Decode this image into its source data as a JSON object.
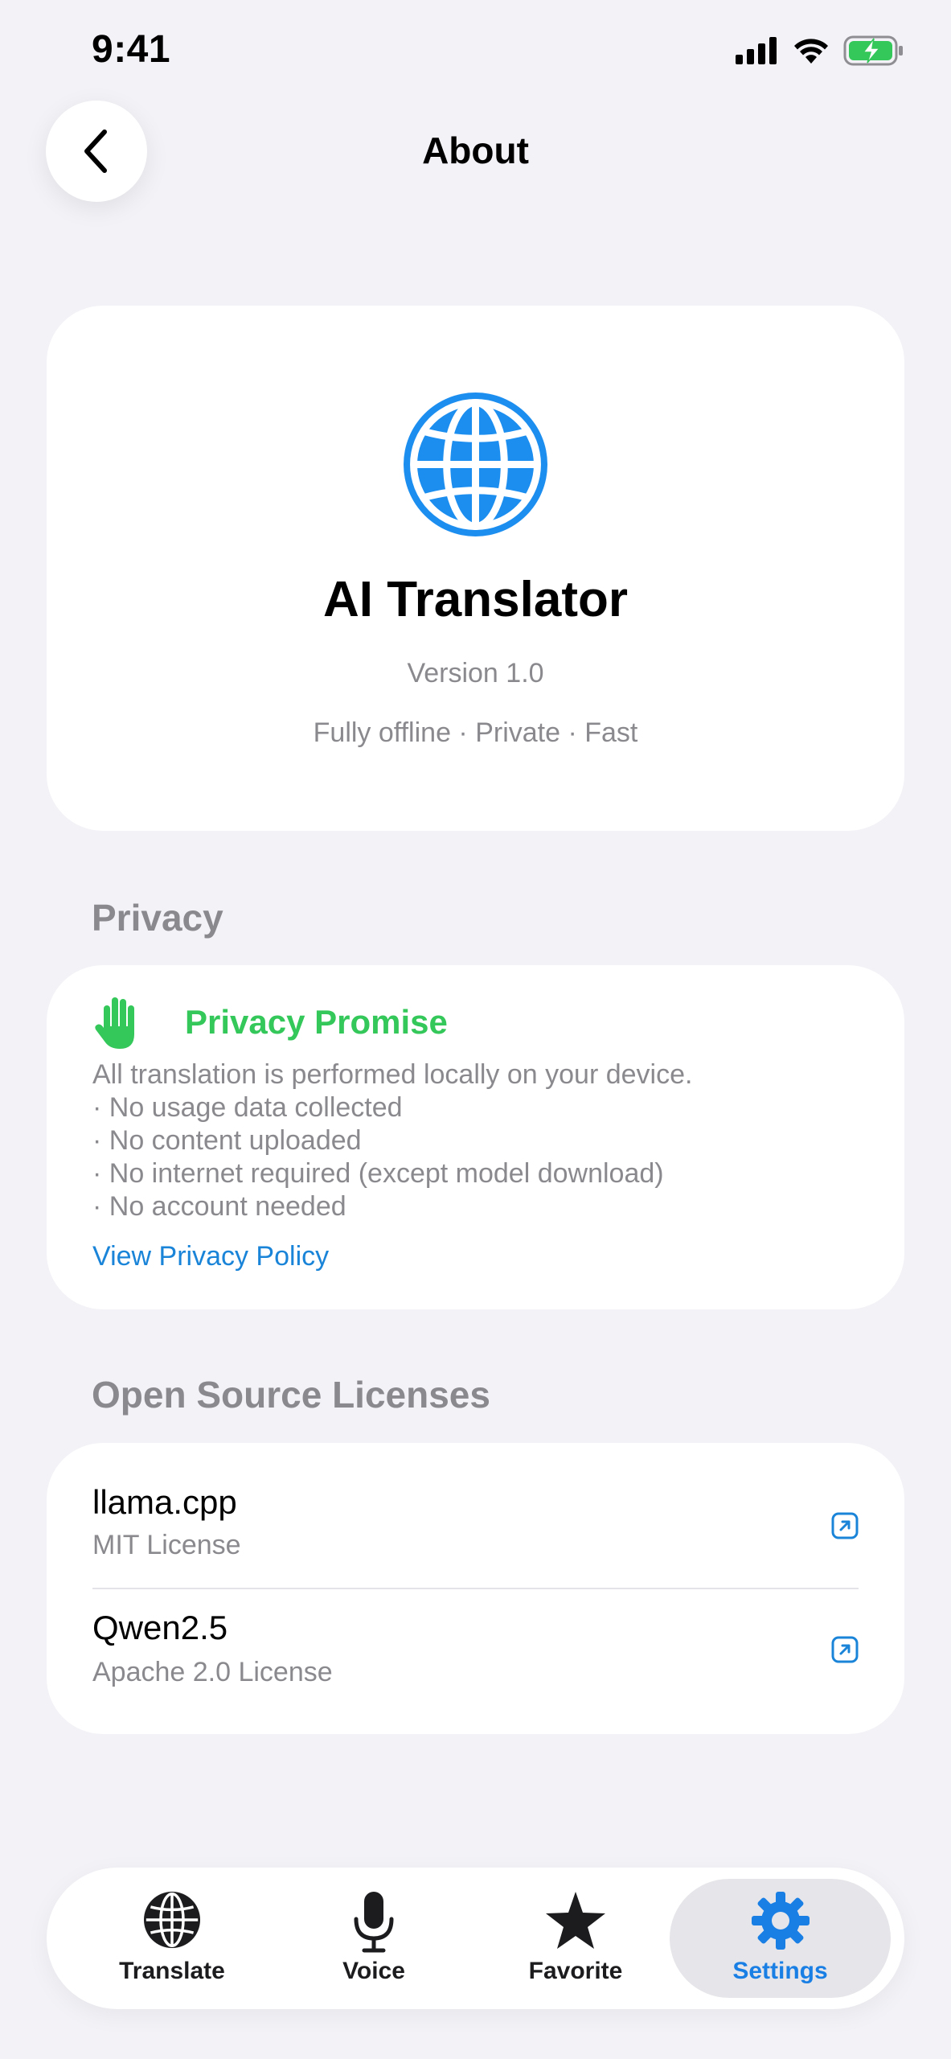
{
  "status_bar": {
    "time": "9:41"
  },
  "header": {
    "title": "About",
    "back_icon": "chevron-left-icon"
  },
  "app_info": {
    "icon": "globe-icon",
    "name": "AI Translator",
    "version": "Version 1.0",
    "tagline": "Fully offline · Private · Fast"
  },
  "privacy": {
    "section_title": "Privacy",
    "card_title": "Privacy Promise",
    "icon": "hand-raised-icon",
    "lines": [
      "All translation is performed locally on your device.",
      "· No usage data collected",
      "· No content uploaded",
      "· No internet required (except model download)",
      "· No account needed"
    ],
    "link_label": "View Privacy Policy"
  },
  "licenses": {
    "section_title": "Open Source Licenses",
    "items": [
      {
        "name": "llama.cpp",
        "license": "MIT License"
      },
      {
        "name": "Qwen2.5",
        "license": "Apache 2.0 License"
      }
    ]
  },
  "tab_bar": {
    "tabs": [
      {
        "label": "Translate",
        "icon": "globe-icon",
        "active": false
      },
      {
        "label": "Voice",
        "icon": "microphone-icon",
        "active": false
      },
      {
        "label": "Favorite",
        "icon": "star-icon",
        "active": false
      },
      {
        "label": "Settings",
        "icon": "gear-icon",
        "active": true
      }
    ]
  },
  "colors": {
    "accent_green": "#34c759",
    "accent_blue": "#1a84d8",
    "globe_blue": "#1c8ef0",
    "background": "#f2f2f7"
  }
}
